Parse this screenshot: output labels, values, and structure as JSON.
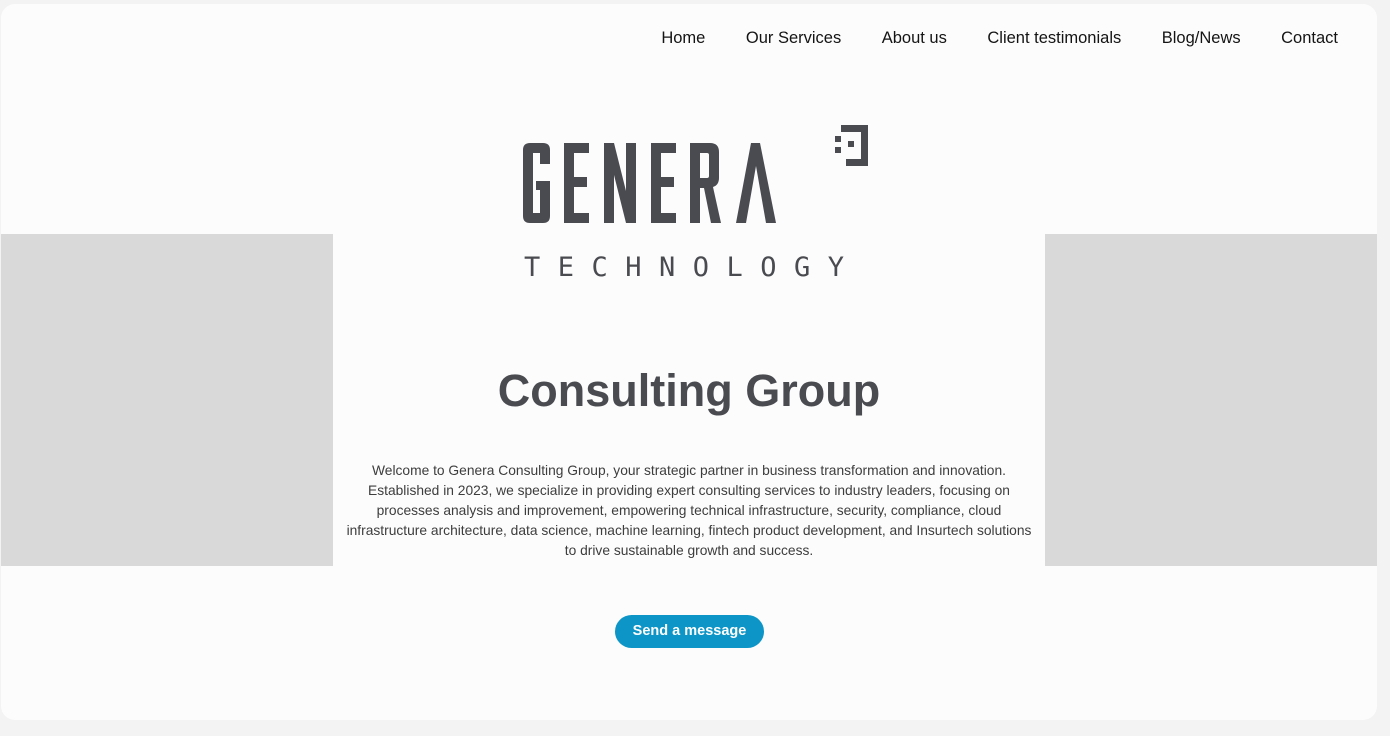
{
  "nav": {
    "items": [
      {
        "label": "Home"
      },
      {
        "label": "Our Services"
      },
      {
        "label": "About us"
      },
      {
        "label": "Client testimonials"
      },
      {
        "label": "Blog/News"
      },
      {
        "label": "Contact"
      }
    ]
  },
  "hero": {
    "logo": {
      "wordmark": "GENERA",
      "subtitle": "TECHNOLOGY",
      "color": "#4a4b50"
    },
    "title": "Consulting Group",
    "intro": "Welcome to Genera Consulting Group, your strategic partner in business transformation and innovation. Established in 2023, we specialize in providing expert consulting services to industry leaders, focusing on processes analysis and improvement, empowering technical infrastructure, security, compliance, cloud infrastructure architecture, data science, machine learning, fintech product development, and Insurtech solutions to drive sustainable growth and success.",
    "cta_label": "Send a message"
  },
  "colors": {
    "page_background": "#f3f3f3",
    "card_background": "#fcfcfc",
    "side_band": "#d9d9d9",
    "accent": "#0c95c6",
    "text_dark": "#4a4b50"
  }
}
